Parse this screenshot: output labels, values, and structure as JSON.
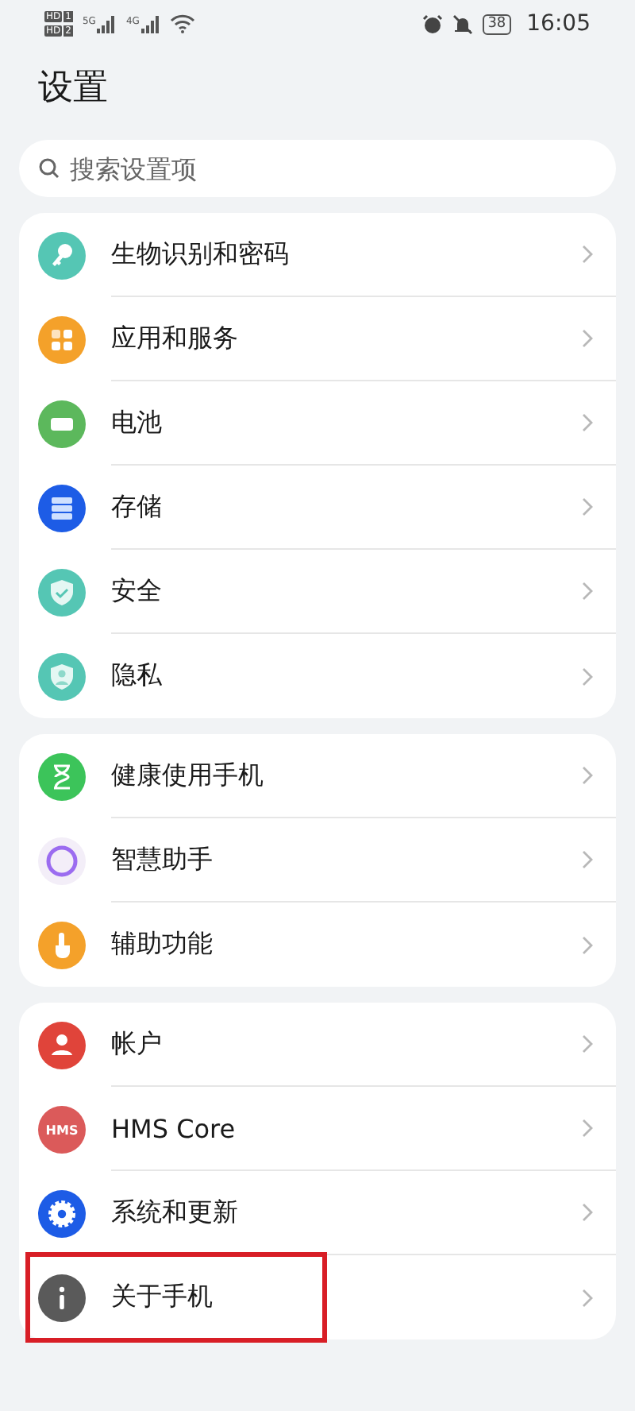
{
  "status_bar": {
    "sims": [
      {
        "badge": "HD",
        "slot": "1"
      },
      {
        "badge": "HD",
        "slot": "2"
      }
    ],
    "networks": [
      "5G",
      "4G"
    ],
    "battery": "38",
    "time": "16:05"
  },
  "title": "设置",
  "search": {
    "placeholder": "搜索设置项"
  },
  "groups": [
    {
      "items": [
        {
          "label": "生物识别和密码",
          "kind": "key",
          "color": "#55c6b4",
          "highlighted": false
        },
        {
          "label": "应用和服务",
          "kind": "apps",
          "color": "#f4a12a",
          "highlighted": false
        },
        {
          "label": "电池",
          "kind": "battery",
          "color": "#5cb85c",
          "highlighted": false
        },
        {
          "label": "存储",
          "kind": "storage",
          "color": "#1d5ce6",
          "highlighted": false
        },
        {
          "label": "安全",
          "kind": "shield",
          "color": "#55c6b4",
          "highlighted": false
        },
        {
          "label": "隐私",
          "kind": "privacy",
          "color": "#55c6b4",
          "highlighted": false
        }
      ]
    },
    {
      "items": [
        {
          "label": "健康使用手机",
          "kind": "hourglass",
          "color": "#3cc45a",
          "highlighted": false
        },
        {
          "label": "智慧助手",
          "kind": "assistant",
          "color": "#f3eef8",
          "highlighted": false
        },
        {
          "label": "辅助功能",
          "kind": "touch",
          "color": "#f4a12a",
          "highlighted": false
        }
      ]
    },
    {
      "items": [
        {
          "label": "帐户",
          "kind": "person",
          "color": "#e0443a",
          "highlighted": false
        },
        {
          "label": "HMS Core",
          "kind": "hms",
          "color": "#db5a5a",
          "icon_text": "HMS",
          "highlighted": false
        },
        {
          "label": "系统和更新",
          "kind": "gear",
          "color": "#1d5ce6",
          "highlighted": false
        },
        {
          "label": "关于手机",
          "kind": "info",
          "color": "#5a5a5a",
          "highlighted": true
        }
      ]
    }
  ]
}
